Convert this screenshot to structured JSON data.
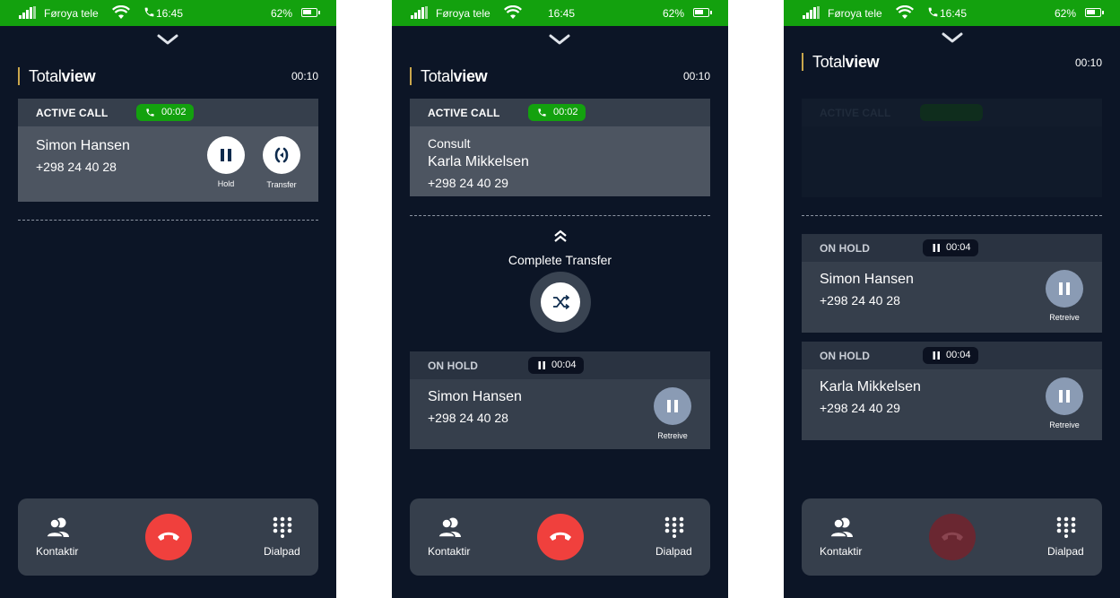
{
  "status_bar": {
    "carrier": "Føroya tele",
    "time": "16:45",
    "battery": "62%"
  },
  "brand": {
    "light": "Total",
    "bold": "view"
  },
  "call_timer": "00:10",
  "screens": [
    {
      "active_call": {
        "label": "ACTIVE CALL",
        "duration": "00:02",
        "name": "Simon Hansen",
        "number": "+298 24 40 28",
        "hold_label": "Hold",
        "transfer_label": "Transfer"
      }
    },
    {
      "active_call": {
        "label": "ACTIVE CALL",
        "duration": "00:02",
        "subtitle": "Consult",
        "name": "Karla Mikkelsen",
        "number": "+298 24 40 29"
      },
      "complete_transfer_label": "Complete Transfer",
      "on_hold": {
        "label": "ON HOLD",
        "duration": "00:04",
        "name": "Simon Hansen",
        "number": "+298 24 40 28",
        "retrieve_label": "Retreive"
      }
    },
    {
      "active_call_faded_label": "ACTIVE CALL",
      "on_hold": [
        {
          "label": "ON HOLD",
          "duration": "00:04",
          "name": "Simon Hansen",
          "number": "+298 24 40 28",
          "retrieve_label": "Retreive"
        },
        {
          "label": "ON HOLD",
          "duration": "00:04",
          "name": "Karla Mikkelsen",
          "number": "+298 24 40 29",
          "retrieve_label": "Retreive"
        }
      ]
    }
  ],
  "bottom_bar": {
    "contacts_label": "Kontaktir",
    "dialpad_label": "Dialpad"
  },
  "colors": {
    "status_green": "#13a10e",
    "background": "#0c1526",
    "hangup_red": "#f0403d",
    "brand_accent": "#c9a64c"
  }
}
